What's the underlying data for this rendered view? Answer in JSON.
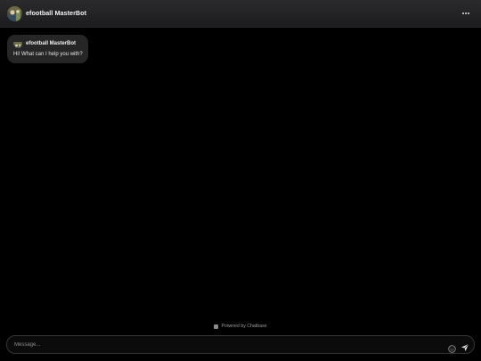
{
  "header": {
    "title": "efootball MasterBot",
    "avatar_icon": "bot-avatar",
    "menu_icon": "more-horizontal-icon"
  },
  "messages": [
    {
      "sender": "efootball MasterBot",
      "text": "Hi! What can I help you with?"
    }
  ],
  "footer": {
    "powered_by": "Powered by Chatbase"
  },
  "composer": {
    "placeholder": "Message...",
    "value": "",
    "emoji_icon": "emoji-icon",
    "send_icon": "send-icon"
  },
  "colors": {
    "background": "#000000",
    "header": "#1c1c1e",
    "bubble": "#262626"
  }
}
